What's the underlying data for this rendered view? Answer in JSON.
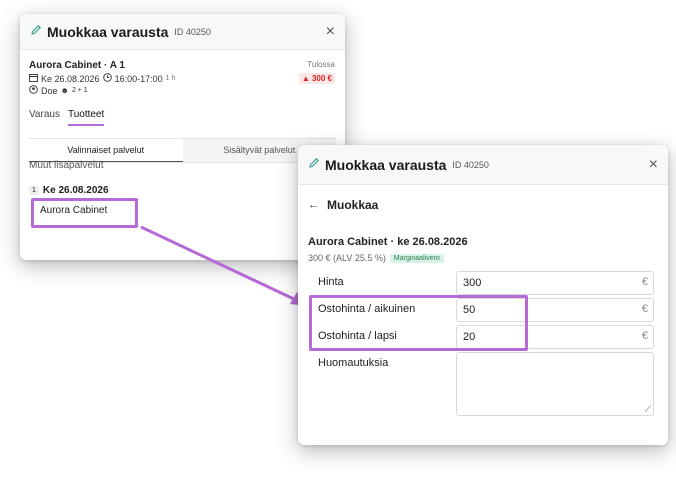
{
  "dialog1": {
    "title": "Muokkaa varausta",
    "id_label": "ID 40250",
    "close": "×",
    "booking_name": "Aurora Cabinet · A 1",
    "status": "Tulossa",
    "date": "Ke 26.08.2026",
    "time": "16:00-17:00",
    "duration": "1 h",
    "customer": "Doe",
    "guests": "2 + 1",
    "price_badge": "300 €",
    "tabs": [
      {
        "label": "Varaus"
      },
      {
        "label": "Tuotteet"
      }
    ],
    "segments": [
      {
        "label": "Valinnaiset palvelut"
      },
      {
        "label": "Sisältyvät palvelut"
      }
    ],
    "section": "Muut lisäpalvelut",
    "day_num": "1",
    "day_label": "Ke 26.08.2026",
    "product": "Aurora Cabinet"
  },
  "dialog2": {
    "title": "Muokkaa varausta",
    "id_label": "ID 40250",
    "close": "×",
    "back_label": "Muokkaa",
    "product_heading": "Aurora Cabinet · ke 26.08.2026",
    "price_line": "300 € (ALV 25.5 %)",
    "tag": "Marginaalivero",
    "fields": [
      {
        "label": "Hinta",
        "value": "300",
        "suffix": "€"
      },
      {
        "label": "Ostohinta / aikuinen",
        "value": "50",
        "suffix": "€"
      },
      {
        "label": "Ostohinta / lapsi",
        "value": "20",
        "suffix": "€"
      }
    ],
    "notes_label": "Huomautuksia"
  },
  "colors": {
    "accent": "#b56ad6",
    "pencil": "#2f9e8a",
    "alert": "#d22222"
  }
}
